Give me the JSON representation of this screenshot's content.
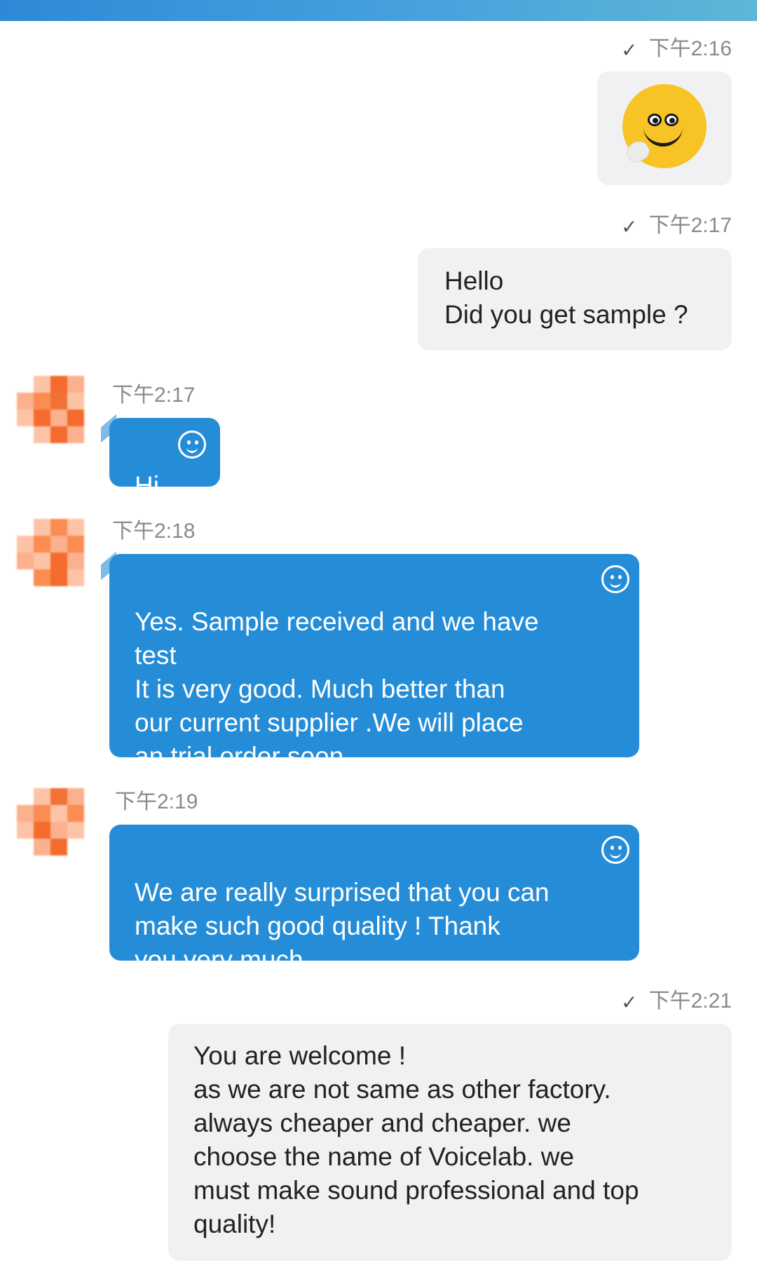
{
  "colors": {
    "outgoing_bubble": "#f1f1f3",
    "incoming_bubble": "#258dd8",
    "timestamp": "#8a8a8a",
    "emoji_yellow": "#f7c325"
  },
  "messages": [
    {
      "direction": "outgoing",
      "time": "下午2:16",
      "type": "sticker",
      "sticker": "smiley-face-sticker",
      "read_icon": "check-icon"
    },
    {
      "direction": "outgoing",
      "time": "下午2:17",
      "type": "text",
      "text": "Hello\nDid you get sample ?",
      "read_icon": "check-icon"
    },
    {
      "direction": "incoming",
      "time": "下午2:17",
      "type": "text",
      "text": "Hi",
      "icon": "smile-icon"
    },
    {
      "direction": "incoming",
      "time": "下午2:18",
      "type": "text",
      "text": "Yes.  Sample received and we have\ntest\nIt is very good.  Much better than\nour current supplier .We will place\nan trial order soon",
      "icon": "smile-icon"
    },
    {
      "direction": "incoming",
      "time": "下午2:19",
      "type": "text",
      "text": "We are really surprised that you can\nmake such good quality ! Thank\nyou very much.",
      "icon": "smile-icon"
    },
    {
      "direction": "outgoing",
      "time": "下午2:21",
      "type": "text",
      "text": "You are welcome !\nas we are not same as other factory.\nalways cheaper and cheaper.  we\nchoose the name of Voicelab.  we\nmust make sound professional and top\nquality!",
      "read_icon": "check-icon"
    }
  ]
}
